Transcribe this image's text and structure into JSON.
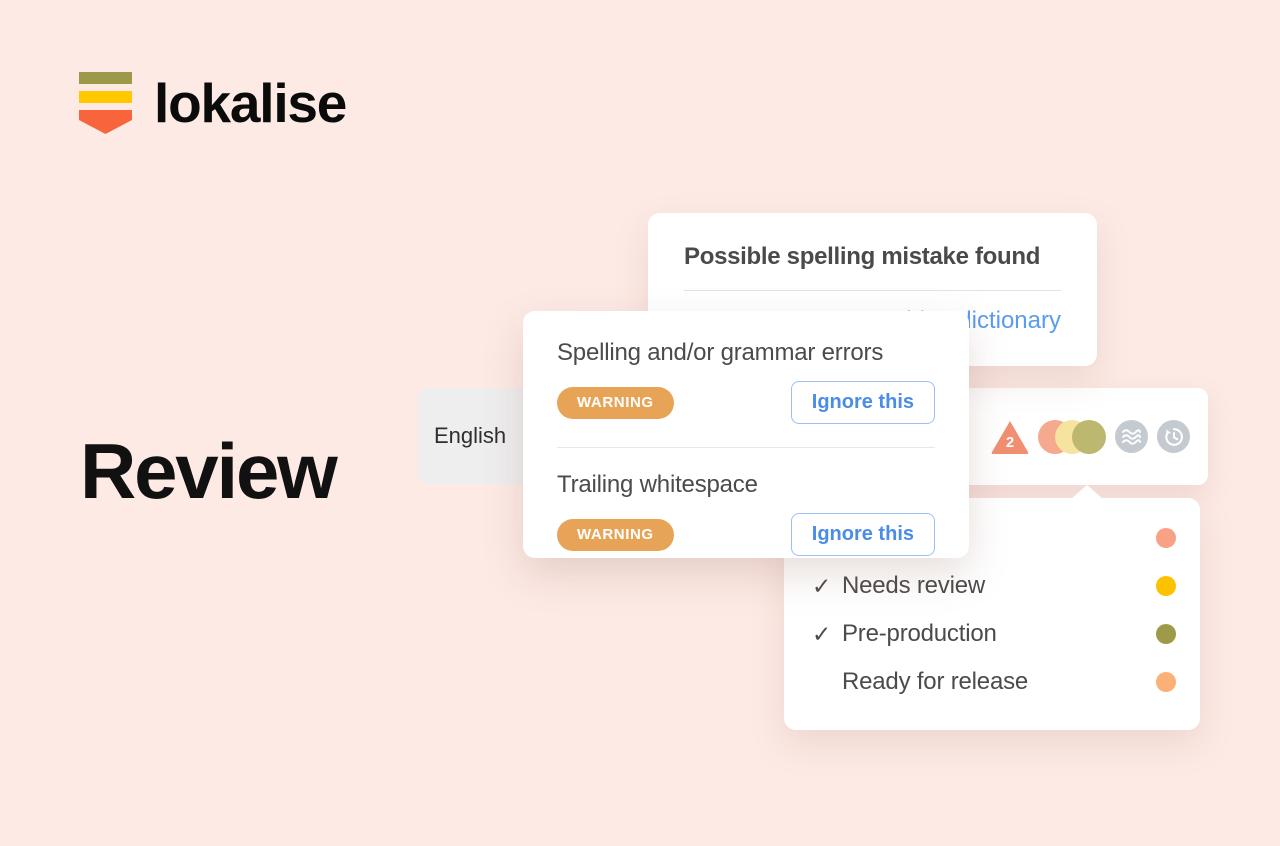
{
  "brand": {
    "name": "lokalise",
    "mark_colors": {
      "bar_olive": "#9a9a4a",
      "bar_yellow": "#ffc800",
      "chevron_orange": "#f8653c"
    }
  },
  "hero": {
    "title": "Review"
  },
  "background_color": "#fdeae5",
  "language_chip": {
    "label": "English"
  },
  "icon_bar": {
    "warning_count": "2",
    "warning_color": "#f08f71",
    "status_dots": [
      {
        "name": "status-dot-salmon",
        "color": "#f5a98f"
      },
      {
        "name": "status-dot-yellow",
        "color": "#f7e3a0"
      },
      {
        "name": "status-dot-olive",
        "color": "#bcb870"
      }
    ],
    "icons": [
      {
        "name": "fuzzy-waves-icon",
        "color": "#c5c9d0"
      },
      {
        "name": "history-clock-icon",
        "color": "#c5c9d0"
      }
    ]
  },
  "spelling_card": {
    "title": "Possible spelling mistake found",
    "link": "Add to dictionary",
    "link_color": "#5b9bf0"
  },
  "qa_popup": {
    "items": [
      {
        "title": "Spelling and/or grammar errors",
        "badge": "WARNING",
        "badge_color": "#e8a456",
        "action": "Ignore this"
      },
      {
        "title": "Trailing whitespace",
        "badge": "WARNING",
        "badge_color": "#e8a456",
        "action": "Ignore this"
      }
    ]
  },
  "status_dropdown": {
    "rows": [
      {
        "label": "",
        "checked": "",
        "dot_color": "#f9a184"
      },
      {
        "label": "Needs review",
        "checked": "✓",
        "dot_color": "#fcc200"
      },
      {
        "label": "Pre-production",
        "checked": "✓",
        "dot_color": "#9d9a4a"
      },
      {
        "label": "Ready for release",
        "checked": "",
        "dot_color": "#fbb078"
      }
    ]
  }
}
